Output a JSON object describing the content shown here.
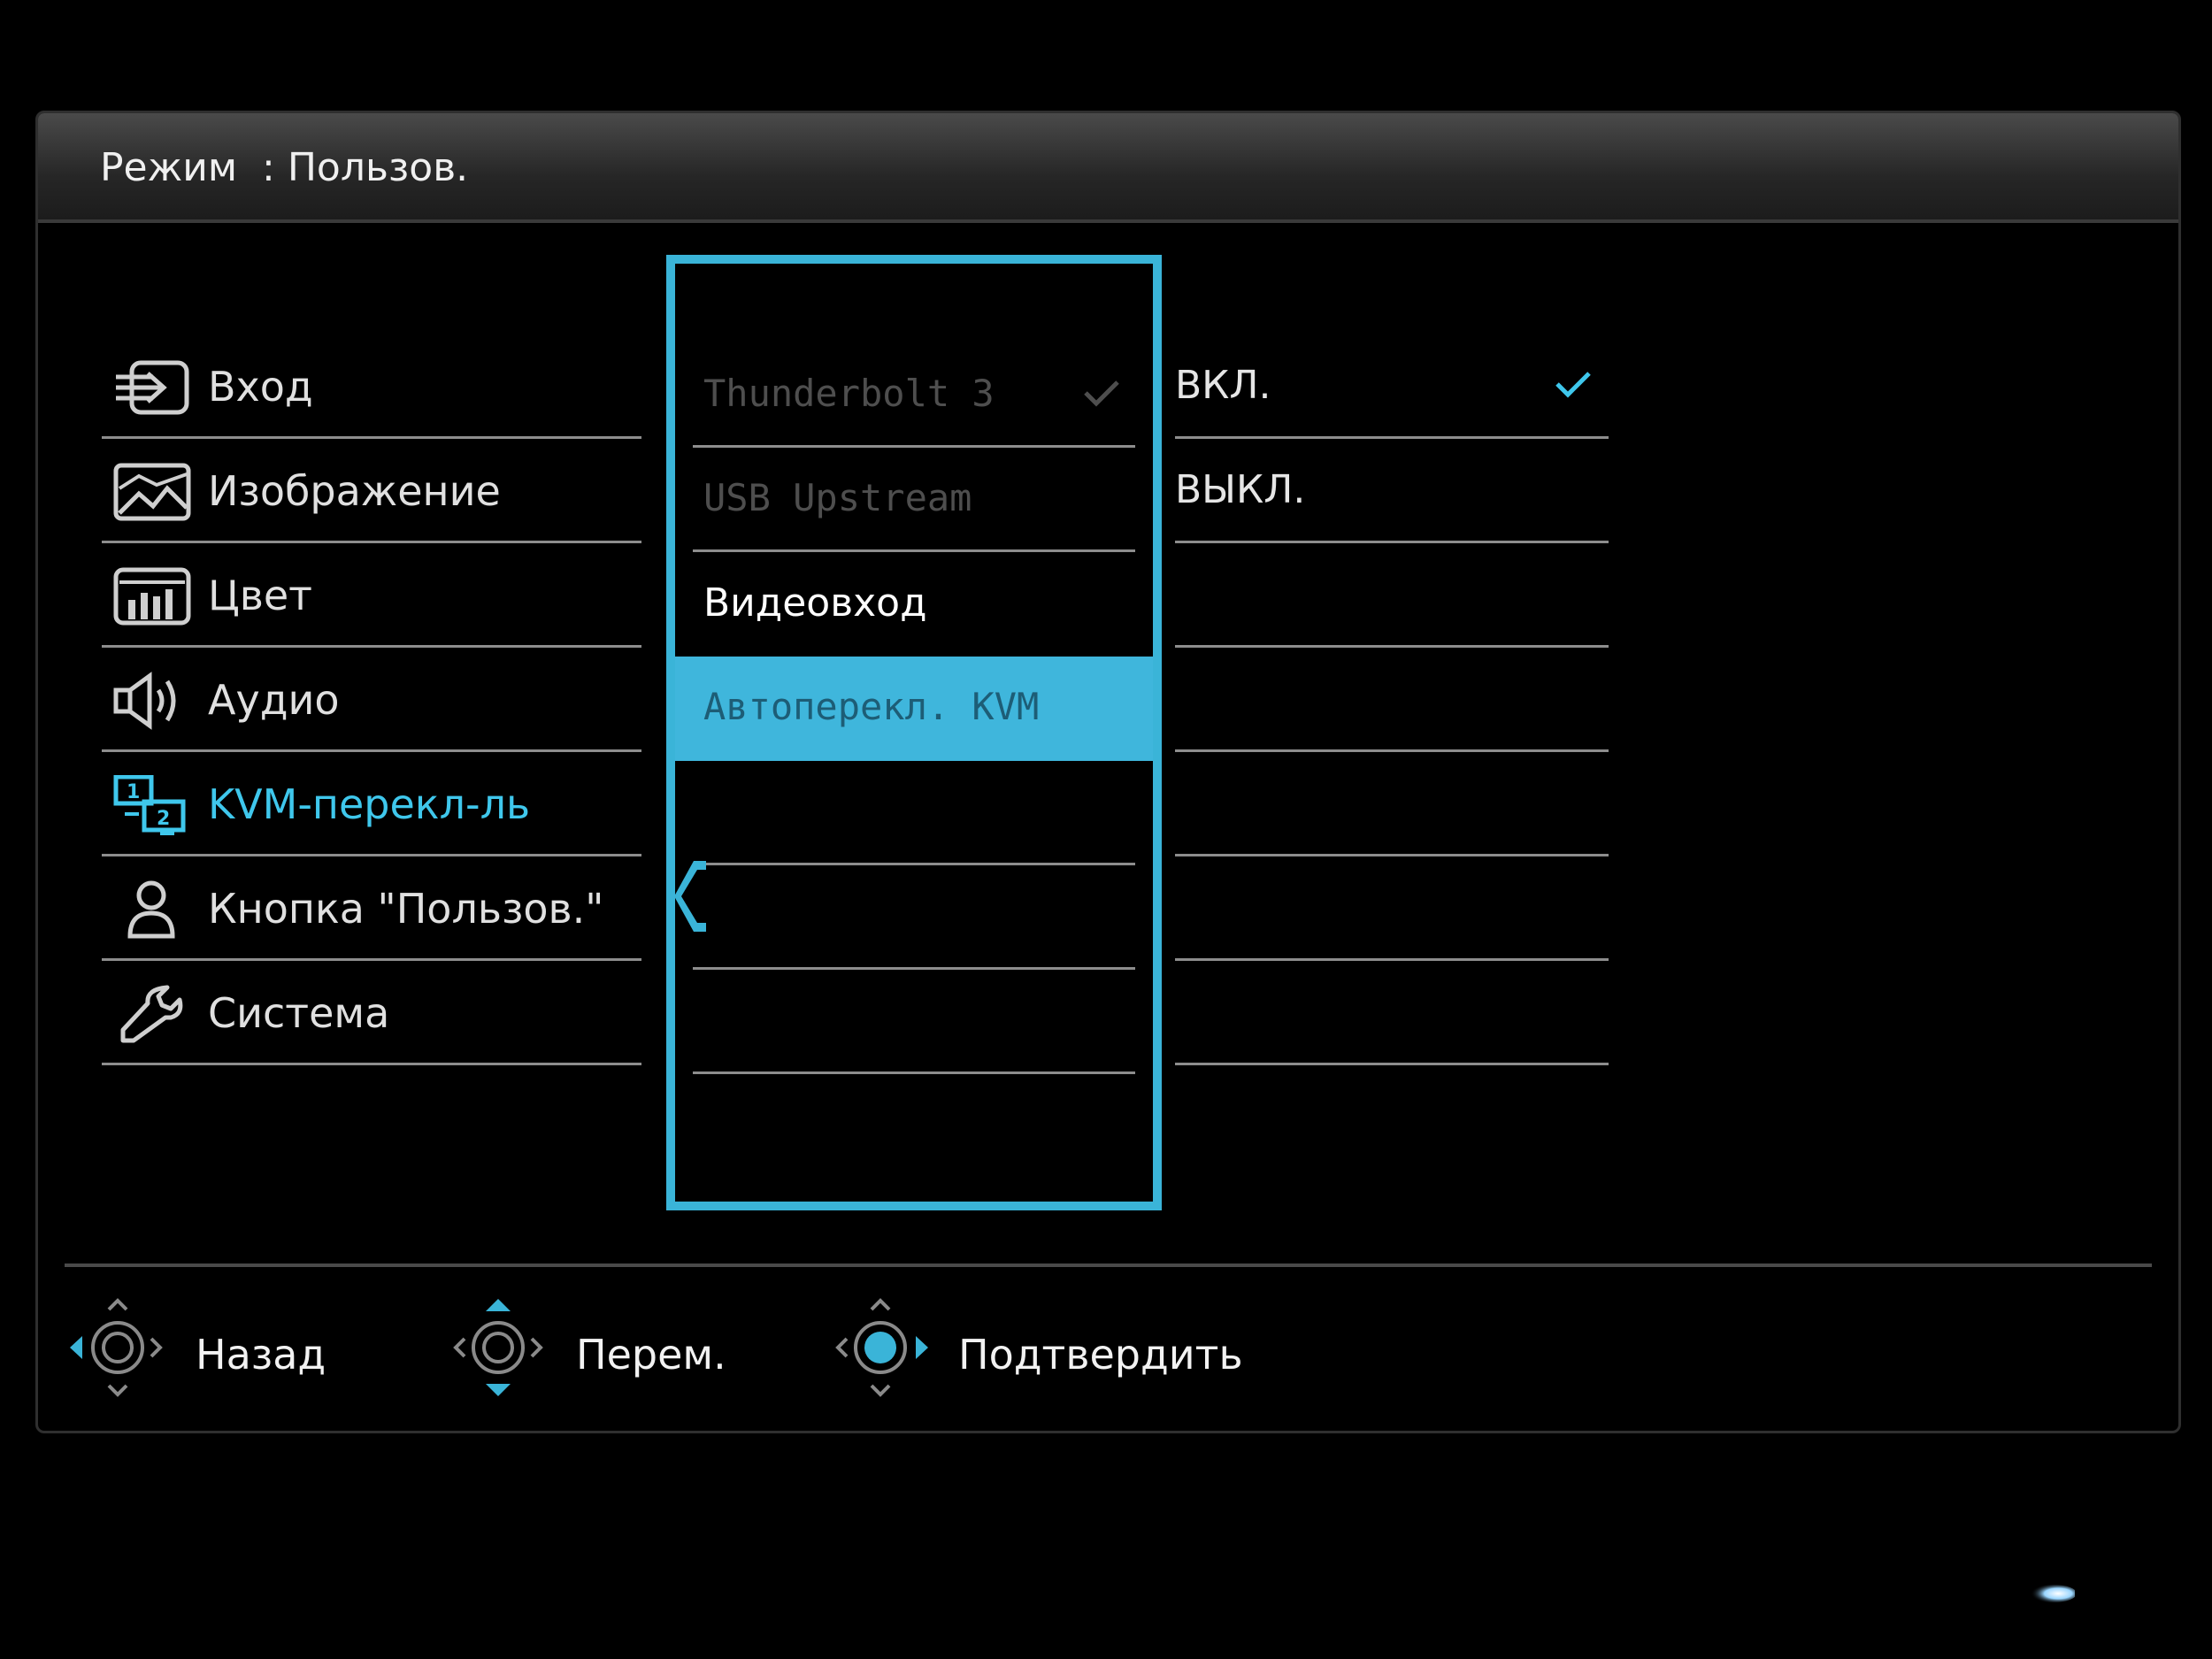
{
  "header": {
    "mode_label": "Режим",
    "mode_separator": ":",
    "mode_value": "Пользов."
  },
  "menu": {
    "items": [
      {
        "label": "Вход",
        "icon": "input-icon"
      },
      {
        "label": "Изображение",
        "icon": "picture-icon"
      },
      {
        "label": "Цвет",
        "icon": "color-icon"
      },
      {
        "label": "Аудио",
        "icon": "speaker-icon"
      },
      {
        "label": "KVM-перекл-ль",
        "icon": "kvm-switch-icon"
      },
      {
        "label": "Кнопка \"Пользов.\"",
        "icon": "user-icon"
      },
      {
        "label": "Система",
        "icon": "wrench-icon"
      }
    ],
    "active_index": 4
  },
  "submenu": {
    "items": [
      {
        "label": "Thunderbolt 3",
        "state": "disabled",
        "checked": true
      },
      {
        "label": "USB Upstream",
        "state": "disabled"
      },
      {
        "label": "Видеовход",
        "state": "current"
      },
      {
        "label": "Автоперекл. KVM",
        "state": "highlighted"
      }
    ]
  },
  "options": {
    "items": [
      {
        "label": "ВКЛ.",
        "checked": true
      },
      {
        "label": "ВЫКЛ."
      }
    ]
  },
  "footer": {
    "back_label": "Назад",
    "move_label": "Перем.",
    "confirm_label": "Подтвердить"
  },
  "colors": {
    "accent": "#3fb6dc",
    "active_text": "#3fc7ec",
    "disabled_text": "#4e4e4e"
  }
}
